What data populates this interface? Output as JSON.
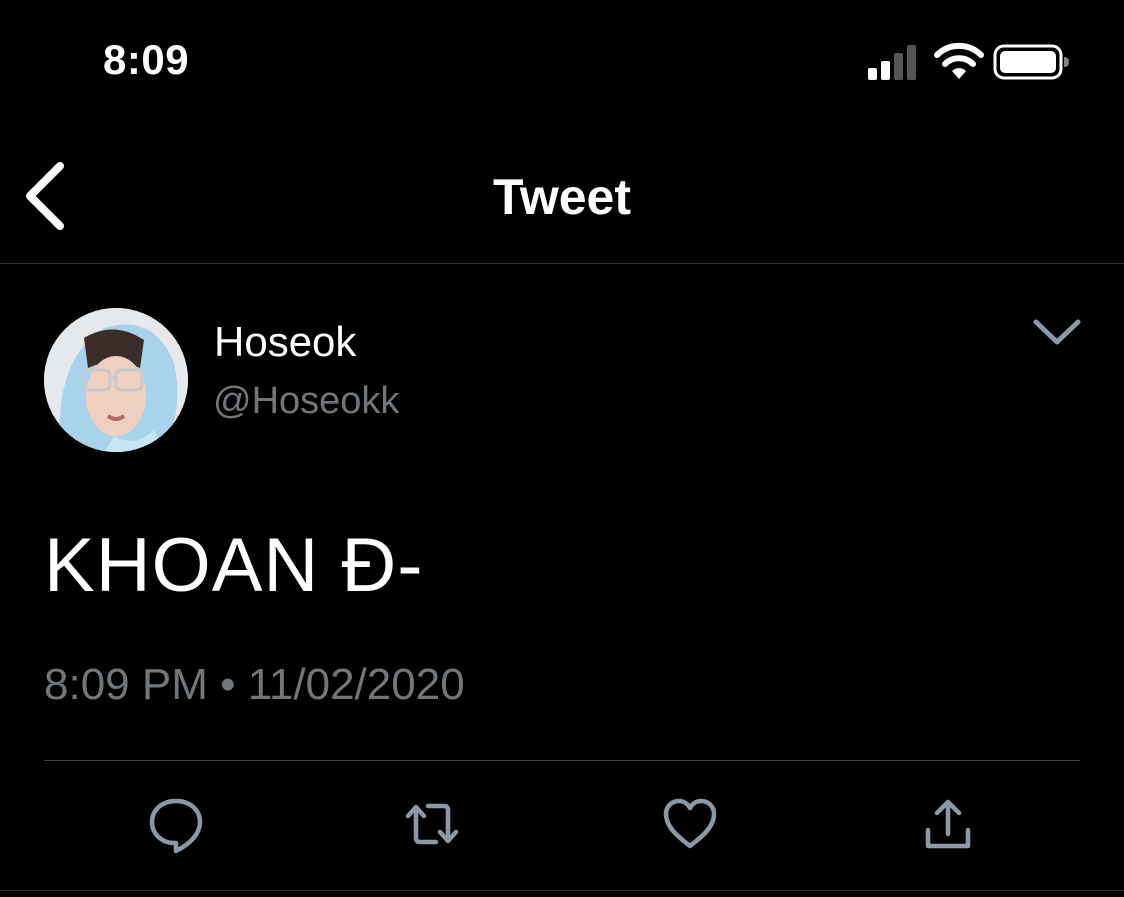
{
  "status_bar": {
    "time": "8:09",
    "icons": [
      "signal-icon",
      "wifi-icon",
      "battery-icon"
    ]
  },
  "nav": {
    "back_icon": "chevron-left-icon",
    "title": "Tweet"
  },
  "tweet": {
    "author": {
      "display_name": "Hoseok",
      "handle": "@Hoseokk"
    },
    "text": "KHOAN Đ-",
    "meta": "8:09 PM • 11/02/2020",
    "more_icon": "chevron-down-icon",
    "actions": [
      {
        "name": "reply",
        "icon": "reply-icon"
      },
      {
        "name": "retweet",
        "icon": "retweet-icon"
      },
      {
        "name": "like",
        "icon": "heart-icon"
      },
      {
        "name": "share",
        "icon": "share-icon"
      }
    ]
  },
  "colors": {
    "background": "#000000",
    "text_primary": "#ffffff",
    "text_secondary": "#71767b",
    "icon": "#8b98a5",
    "divider": "#2f3336"
  }
}
